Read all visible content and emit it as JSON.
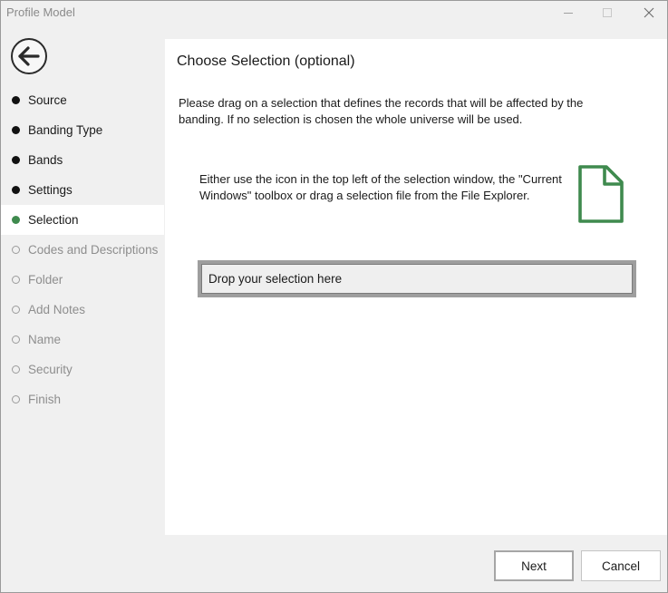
{
  "window": {
    "title": "Profile Model"
  },
  "nav": {
    "items": [
      {
        "label": "Source",
        "state": "done"
      },
      {
        "label": "Banding Type",
        "state": "done"
      },
      {
        "label": "Bands",
        "state": "done"
      },
      {
        "label": "Settings",
        "state": "done"
      },
      {
        "label": "Selection",
        "state": "active"
      },
      {
        "label": "Codes and Descriptions",
        "state": "todo"
      },
      {
        "label": "Folder",
        "state": "todo"
      },
      {
        "label": "Add Notes",
        "state": "todo"
      },
      {
        "label": "Name",
        "state": "todo"
      },
      {
        "label": "Security",
        "state": "todo"
      },
      {
        "label": "Finish",
        "state": "todo"
      }
    ]
  },
  "content": {
    "title": "Choose Selection (optional)",
    "description": "Please drag on a selection that defines the records that will be affected by the banding.  If no selection is chosen the whole universe will be used.",
    "instructions": "Either use the icon in the top left of the selection window, the \"Current Windows\" toolbox or drag a selection file from the File Explorer.",
    "dropzone_label": "Drop your selection here"
  },
  "buttons": {
    "next": "Next",
    "cancel": "Cancel"
  },
  "colors": {
    "accent": "#3f8a4e",
    "done_dot": "#111111",
    "todo_text": "#8e8e8e"
  },
  "icons": {
    "back": "back-arrow-icon",
    "file": "file-icon",
    "minimize": "minimize-icon",
    "maximize": "maximize-icon",
    "close": "close-icon"
  }
}
